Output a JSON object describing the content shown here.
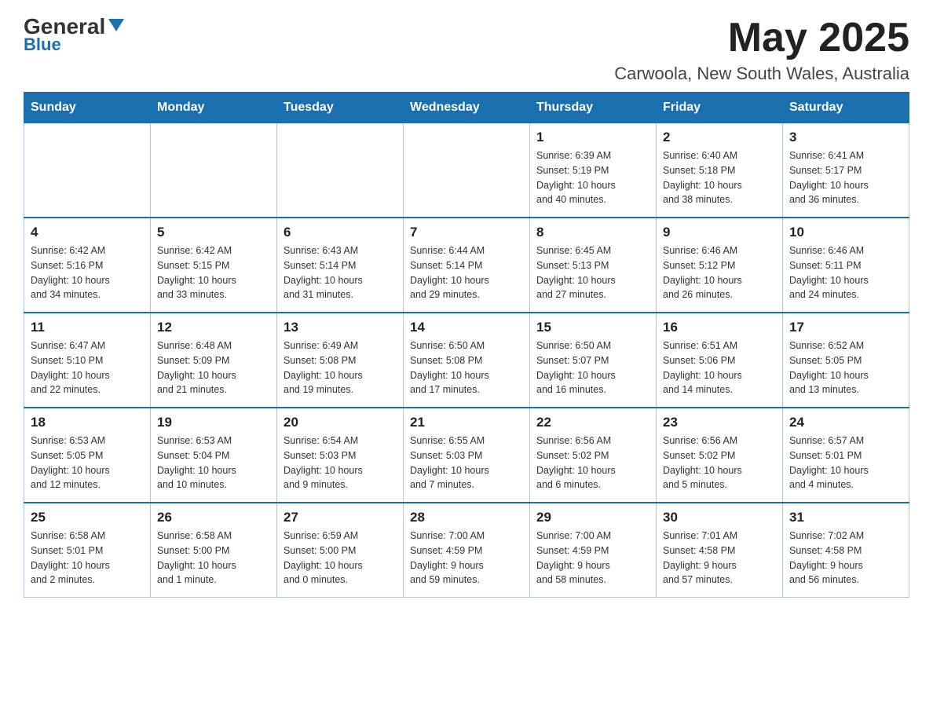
{
  "header": {
    "logo_general": "General",
    "logo_blue": "Blue",
    "month_title": "May 2025",
    "location": "Carwoola, New South Wales, Australia"
  },
  "days_of_week": [
    "Sunday",
    "Monday",
    "Tuesday",
    "Wednesday",
    "Thursday",
    "Friday",
    "Saturday"
  ],
  "weeks": [
    [
      {
        "day": "",
        "info": ""
      },
      {
        "day": "",
        "info": ""
      },
      {
        "day": "",
        "info": ""
      },
      {
        "day": "",
        "info": ""
      },
      {
        "day": "1",
        "info": "Sunrise: 6:39 AM\nSunset: 5:19 PM\nDaylight: 10 hours\nand 40 minutes."
      },
      {
        "day": "2",
        "info": "Sunrise: 6:40 AM\nSunset: 5:18 PM\nDaylight: 10 hours\nand 38 minutes."
      },
      {
        "day": "3",
        "info": "Sunrise: 6:41 AM\nSunset: 5:17 PM\nDaylight: 10 hours\nand 36 minutes."
      }
    ],
    [
      {
        "day": "4",
        "info": "Sunrise: 6:42 AM\nSunset: 5:16 PM\nDaylight: 10 hours\nand 34 minutes."
      },
      {
        "day": "5",
        "info": "Sunrise: 6:42 AM\nSunset: 5:15 PM\nDaylight: 10 hours\nand 33 minutes."
      },
      {
        "day": "6",
        "info": "Sunrise: 6:43 AM\nSunset: 5:14 PM\nDaylight: 10 hours\nand 31 minutes."
      },
      {
        "day": "7",
        "info": "Sunrise: 6:44 AM\nSunset: 5:14 PM\nDaylight: 10 hours\nand 29 minutes."
      },
      {
        "day": "8",
        "info": "Sunrise: 6:45 AM\nSunset: 5:13 PM\nDaylight: 10 hours\nand 27 minutes."
      },
      {
        "day": "9",
        "info": "Sunrise: 6:46 AM\nSunset: 5:12 PM\nDaylight: 10 hours\nand 26 minutes."
      },
      {
        "day": "10",
        "info": "Sunrise: 6:46 AM\nSunset: 5:11 PM\nDaylight: 10 hours\nand 24 minutes."
      }
    ],
    [
      {
        "day": "11",
        "info": "Sunrise: 6:47 AM\nSunset: 5:10 PM\nDaylight: 10 hours\nand 22 minutes."
      },
      {
        "day": "12",
        "info": "Sunrise: 6:48 AM\nSunset: 5:09 PM\nDaylight: 10 hours\nand 21 minutes."
      },
      {
        "day": "13",
        "info": "Sunrise: 6:49 AM\nSunset: 5:08 PM\nDaylight: 10 hours\nand 19 minutes."
      },
      {
        "day": "14",
        "info": "Sunrise: 6:50 AM\nSunset: 5:08 PM\nDaylight: 10 hours\nand 17 minutes."
      },
      {
        "day": "15",
        "info": "Sunrise: 6:50 AM\nSunset: 5:07 PM\nDaylight: 10 hours\nand 16 minutes."
      },
      {
        "day": "16",
        "info": "Sunrise: 6:51 AM\nSunset: 5:06 PM\nDaylight: 10 hours\nand 14 minutes."
      },
      {
        "day": "17",
        "info": "Sunrise: 6:52 AM\nSunset: 5:05 PM\nDaylight: 10 hours\nand 13 minutes."
      }
    ],
    [
      {
        "day": "18",
        "info": "Sunrise: 6:53 AM\nSunset: 5:05 PM\nDaylight: 10 hours\nand 12 minutes."
      },
      {
        "day": "19",
        "info": "Sunrise: 6:53 AM\nSunset: 5:04 PM\nDaylight: 10 hours\nand 10 minutes."
      },
      {
        "day": "20",
        "info": "Sunrise: 6:54 AM\nSunset: 5:03 PM\nDaylight: 10 hours\nand 9 minutes."
      },
      {
        "day": "21",
        "info": "Sunrise: 6:55 AM\nSunset: 5:03 PM\nDaylight: 10 hours\nand 7 minutes."
      },
      {
        "day": "22",
        "info": "Sunrise: 6:56 AM\nSunset: 5:02 PM\nDaylight: 10 hours\nand 6 minutes."
      },
      {
        "day": "23",
        "info": "Sunrise: 6:56 AM\nSunset: 5:02 PM\nDaylight: 10 hours\nand 5 minutes."
      },
      {
        "day": "24",
        "info": "Sunrise: 6:57 AM\nSunset: 5:01 PM\nDaylight: 10 hours\nand 4 minutes."
      }
    ],
    [
      {
        "day": "25",
        "info": "Sunrise: 6:58 AM\nSunset: 5:01 PM\nDaylight: 10 hours\nand 2 minutes."
      },
      {
        "day": "26",
        "info": "Sunrise: 6:58 AM\nSunset: 5:00 PM\nDaylight: 10 hours\nand 1 minute."
      },
      {
        "day": "27",
        "info": "Sunrise: 6:59 AM\nSunset: 5:00 PM\nDaylight: 10 hours\nand 0 minutes."
      },
      {
        "day": "28",
        "info": "Sunrise: 7:00 AM\nSunset: 4:59 PM\nDaylight: 9 hours\nand 59 minutes."
      },
      {
        "day": "29",
        "info": "Sunrise: 7:00 AM\nSunset: 4:59 PM\nDaylight: 9 hours\nand 58 minutes."
      },
      {
        "day": "30",
        "info": "Sunrise: 7:01 AM\nSunset: 4:58 PM\nDaylight: 9 hours\nand 57 minutes."
      },
      {
        "day": "31",
        "info": "Sunrise: 7:02 AM\nSunset: 4:58 PM\nDaylight: 9 hours\nand 56 minutes."
      }
    ]
  ]
}
